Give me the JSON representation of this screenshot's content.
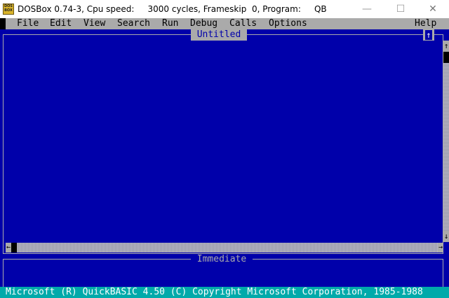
{
  "window": {
    "title": "DOSBox 0.74-3, Cpu speed:     3000 cycles, Frameskip  0, Program:     QB",
    "icon_text": [
      "DOS",
      "BOX"
    ],
    "minimize": "—",
    "maximize": "☐",
    "close": "✕"
  },
  "menu": {
    "file": "File",
    "edit": "Edit",
    "view": "View",
    "search": "Search",
    "run": "Run",
    "debug": "Debug",
    "calls": "Calls",
    "options": "Options",
    "help": "Help"
  },
  "editor": {
    "title": "Untitled",
    "maximize_glyph": "↑"
  },
  "scrollbar": {
    "up": "↑",
    "down": "↓",
    "left": "←",
    "right": "→"
  },
  "immediate": {
    "title": "Immediate"
  },
  "status": {
    "text": "Microsoft (R) QuickBASIC 4.50 (C) Copyright Microsoft Corporation, 1985-1988"
  }
}
